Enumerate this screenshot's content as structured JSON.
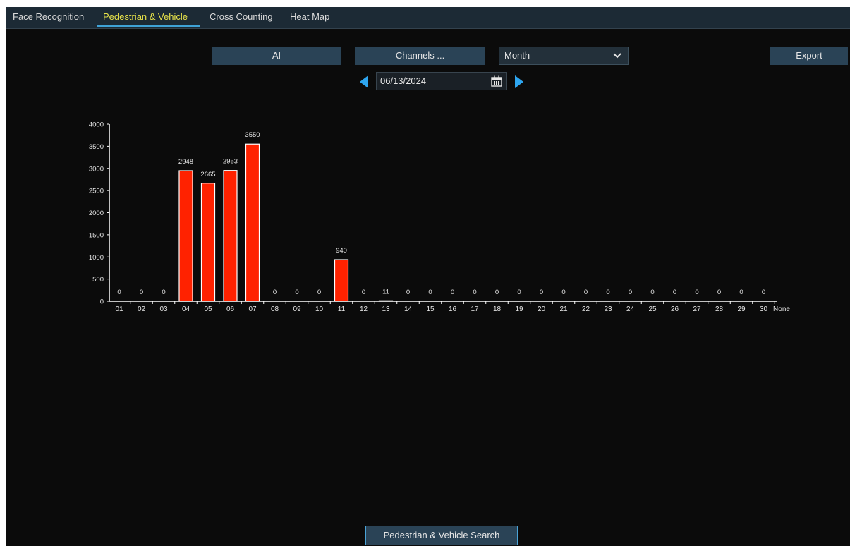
{
  "tabs": [
    {
      "label": "Face Recognition",
      "active": false
    },
    {
      "label": "Pedestrian & Vehicle",
      "active": true
    },
    {
      "label": "Cross Counting",
      "active": false
    },
    {
      "label": "Heat Map",
      "active": false
    }
  ],
  "toolbar": {
    "ai_label": "AI",
    "channels_label": "Channels ...",
    "period_value": "Month",
    "export_label": "Export"
  },
  "date": {
    "value": "06/13/2024",
    "prev_icon": "chevron-left-icon",
    "next_icon": "chevron-right-icon",
    "calendar_icon": "calendar-icon"
  },
  "colors": {
    "bar": "#ff2200",
    "accent": "#3fa3d8",
    "active_tab": "#e8e34a"
  },
  "search_button_label": "Pedestrian & Vehicle Search",
  "chart_data": {
    "type": "bar",
    "categories": [
      "01",
      "02",
      "03",
      "04",
      "05",
      "06",
      "07",
      "08",
      "09",
      "10",
      "11",
      "12",
      "13",
      "14",
      "15",
      "16",
      "17",
      "18",
      "19",
      "20",
      "21",
      "22",
      "23",
      "24",
      "25",
      "26",
      "27",
      "28",
      "29",
      "30",
      "None"
    ],
    "values": [
      0,
      0,
      0,
      2948,
      2665,
      2953,
      3550,
      0,
      0,
      0,
      940,
      0,
      11,
      0,
      0,
      0,
      0,
      0,
      0,
      0,
      0,
      0,
      0,
      0,
      0,
      0,
      0,
      0,
      0,
      0
    ],
    "ylim": [
      0,
      4000
    ],
    "yticks": [
      0,
      500,
      1000,
      1500,
      2000,
      2500,
      3000,
      3500,
      4000
    ],
    "title": "",
    "xlabel": "",
    "ylabel": "",
    "grid": false
  }
}
